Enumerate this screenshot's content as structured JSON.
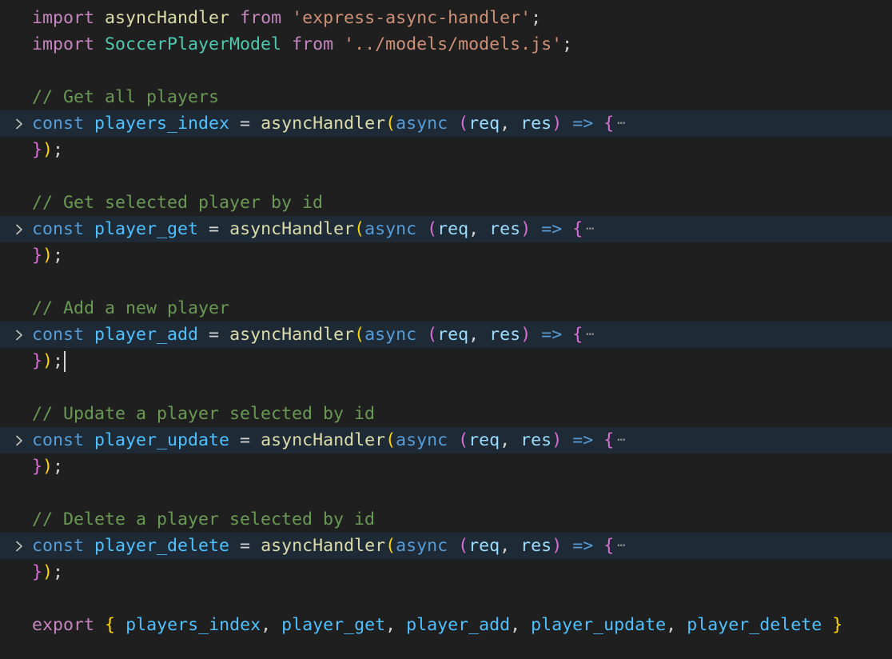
{
  "editor": {
    "language": "javascript",
    "theme_colors": {
      "background": "#1f1f1f",
      "folded_line_background": "#1e2a36",
      "keyword_import": "#c586c0",
      "keyword_decl": "#569cd6",
      "variable": "#4fc1ff",
      "parameter": "#9cdcfe",
      "function": "#dcdcaa",
      "class": "#4ec9b0",
      "string": "#ce9178",
      "comment": "#6a9955",
      "bracket_level_1": "#ffd700",
      "bracket_level_2": "#da70d6",
      "bracket_level_3": "#179fff"
    },
    "fold_icon": "chevron-right-icon",
    "folded_ellipsis": "⋯",
    "cursor_line": 11,
    "lines": [
      {
        "tokens": [
          [
            "t-kw-import",
            "import"
          ],
          [
            "t-op",
            " "
          ],
          [
            "t-fn",
            "asyncHandler"
          ],
          [
            "t-op",
            " "
          ],
          [
            "t-kw-import",
            "from"
          ],
          [
            "t-op",
            " "
          ],
          [
            "t-str",
            "'express-async-handler'"
          ],
          [
            "t-pun",
            ";"
          ]
        ]
      },
      {
        "tokens": [
          [
            "t-kw-import",
            "import"
          ],
          [
            "t-op",
            " "
          ],
          [
            "t-cls",
            "SoccerPlayerModel"
          ],
          [
            "t-op",
            " "
          ],
          [
            "t-kw-import",
            "from"
          ],
          [
            "t-op",
            " "
          ],
          [
            "t-str",
            "'../models/models.js'"
          ],
          [
            "t-pun",
            ";"
          ]
        ]
      },
      {
        "tokens": []
      },
      {
        "tokens": [
          [
            "t-cmt",
            "// Get all players"
          ]
        ]
      },
      {
        "folded": true,
        "tokens": [
          [
            "t-kw-decl",
            "const"
          ],
          [
            "t-op",
            " "
          ],
          [
            "t-var",
            "players_index"
          ],
          [
            "t-op",
            " = "
          ],
          [
            "t-fn",
            "asyncHandler"
          ],
          [
            "b1",
            "("
          ],
          [
            "t-kw-decl",
            "async"
          ],
          [
            "t-op",
            " "
          ],
          [
            "b2",
            "("
          ],
          [
            "t-param",
            "req"
          ],
          [
            "t-pun",
            ", "
          ],
          [
            "t-param",
            "res"
          ],
          [
            "b2",
            ")"
          ],
          [
            "t-op",
            " "
          ],
          [
            "t-arrow",
            "=>"
          ],
          [
            "t-op",
            " "
          ],
          [
            "b2",
            "{"
          ]
        ]
      },
      {
        "tokens": [
          [
            "b2",
            "}"
          ],
          [
            "b1",
            ")"
          ],
          [
            "t-pun",
            ";"
          ]
        ]
      },
      {
        "tokens": []
      },
      {
        "tokens": [
          [
            "t-cmt",
            "// Get selected player by id"
          ]
        ]
      },
      {
        "folded": true,
        "tokens": [
          [
            "t-kw-decl",
            "const"
          ],
          [
            "t-op",
            " "
          ],
          [
            "t-var",
            "player_get"
          ],
          [
            "t-op",
            " = "
          ],
          [
            "t-fn",
            "asyncHandler"
          ],
          [
            "b1",
            "("
          ],
          [
            "t-kw-decl",
            "async"
          ],
          [
            "t-op",
            " "
          ],
          [
            "b2",
            "("
          ],
          [
            "t-param",
            "req"
          ],
          [
            "t-pun",
            ", "
          ],
          [
            "t-param",
            "res"
          ],
          [
            "b2",
            ")"
          ],
          [
            "t-op",
            " "
          ],
          [
            "t-arrow",
            "=>"
          ],
          [
            "t-op",
            " "
          ],
          [
            "b2",
            "{"
          ]
        ]
      },
      {
        "tokens": [
          [
            "b2",
            "}"
          ],
          [
            "b1",
            ")"
          ],
          [
            "t-pun",
            ";"
          ]
        ]
      },
      {
        "tokens": []
      },
      {
        "tokens": [
          [
            "t-cmt",
            "// Add a new player"
          ]
        ]
      },
      {
        "folded": true,
        "tokens": [
          [
            "t-kw-decl",
            "const"
          ],
          [
            "t-op",
            " "
          ],
          [
            "t-var",
            "player_add"
          ],
          [
            "t-op",
            " = "
          ],
          [
            "t-fn",
            "asyncHandler"
          ],
          [
            "b1",
            "("
          ],
          [
            "t-kw-decl",
            "async"
          ],
          [
            "t-op",
            " "
          ],
          [
            "b2",
            "("
          ],
          [
            "t-param",
            "req"
          ],
          [
            "t-pun",
            ", "
          ],
          [
            "t-param",
            "res"
          ],
          [
            "b2",
            ")"
          ],
          [
            "t-op",
            " "
          ],
          [
            "t-arrow",
            "=>"
          ],
          [
            "t-op",
            " "
          ],
          [
            "b2",
            "{"
          ]
        ]
      },
      {
        "tokens": [
          [
            "b2",
            "}"
          ],
          [
            "b1",
            ")"
          ],
          [
            "t-pun",
            ";"
          ]
        ],
        "caret": true
      },
      {
        "tokens": []
      },
      {
        "tokens": [
          [
            "t-cmt",
            "// Update a player selected by id"
          ]
        ]
      },
      {
        "folded": true,
        "tokens": [
          [
            "t-kw-decl",
            "const"
          ],
          [
            "t-op",
            " "
          ],
          [
            "t-var",
            "player_update"
          ],
          [
            "t-op",
            " = "
          ],
          [
            "t-fn",
            "asyncHandler"
          ],
          [
            "b1",
            "("
          ],
          [
            "t-kw-decl",
            "async"
          ],
          [
            "t-op",
            " "
          ],
          [
            "b2",
            "("
          ],
          [
            "t-param",
            "req"
          ],
          [
            "t-pun",
            ", "
          ],
          [
            "t-param",
            "res"
          ],
          [
            "b2",
            ")"
          ],
          [
            "t-op",
            " "
          ],
          [
            "t-arrow",
            "=>"
          ],
          [
            "t-op",
            " "
          ],
          [
            "b2",
            "{"
          ]
        ]
      },
      {
        "tokens": [
          [
            "b2",
            "}"
          ],
          [
            "b1",
            ")"
          ],
          [
            "t-pun",
            ";"
          ]
        ]
      },
      {
        "tokens": []
      },
      {
        "tokens": [
          [
            "t-cmt",
            "// Delete a player selected by id"
          ]
        ]
      },
      {
        "folded": true,
        "tokens": [
          [
            "t-kw-decl",
            "const"
          ],
          [
            "t-op",
            " "
          ],
          [
            "t-var",
            "player_delete"
          ],
          [
            "t-op",
            " = "
          ],
          [
            "t-fn",
            "asyncHandler"
          ],
          [
            "b1",
            "("
          ],
          [
            "t-kw-decl",
            "async"
          ],
          [
            "t-op",
            " "
          ],
          [
            "b2",
            "("
          ],
          [
            "t-param",
            "req"
          ],
          [
            "t-pun",
            ", "
          ],
          [
            "t-param",
            "res"
          ],
          [
            "b2",
            ")"
          ],
          [
            "t-op",
            " "
          ],
          [
            "t-arrow",
            "=>"
          ],
          [
            "t-op",
            " "
          ],
          [
            "b2",
            "{"
          ]
        ]
      },
      {
        "tokens": [
          [
            "b2",
            "}"
          ],
          [
            "b1",
            ")"
          ],
          [
            "t-pun",
            ";"
          ]
        ]
      },
      {
        "tokens": []
      },
      {
        "tokens": [
          [
            "t-kw-import",
            "export"
          ],
          [
            "t-op",
            " "
          ],
          [
            "b1",
            "{"
          ],
          [
            "t-op",
            " "
          ],
          [
            "t-var",
            "players_index"
          ],
          [
            "t-pun",
            ", "
          ],
          [
            "t-var",
            "player_get"
          ],
          [
            "t-pun",
            ", "
          ],
          [
            "t-var",
            "player_add"
          ],
          [
            "t-pun",
            ", "
          ],
          [
            "t-var",
            "player_update"
          ],
          [
            "t-pun",
            ", "
          ],
          [
            "t-var",
            "player_delete"
          ],
          [
            "t-op",
            " "
          ],
          [
            "b1",
            "}"
          ]
        ]
      }
    ]
  }
}
